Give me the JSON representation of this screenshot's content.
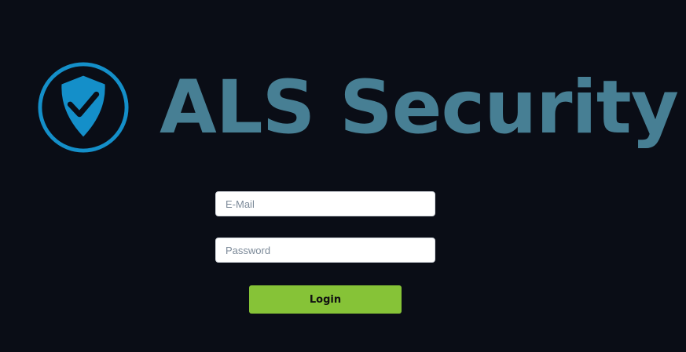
{
  "brand": {
    "name": "ALS Security",
    "logo_icon": "shield-check-icon"
  },
  "login_form": {
    "email_placeholder": "E-Mail",
    "email_value": "",
    "password_placeholder": "Password",
    "password_value": "",
    "login_label": "Login"
  },
  "colors": {
    "background": "#0a0d16",
    "brand_text": "#477f94",
    "logo_blue": "#148fc9",
    "button_green": "#86c337"
  }
}
